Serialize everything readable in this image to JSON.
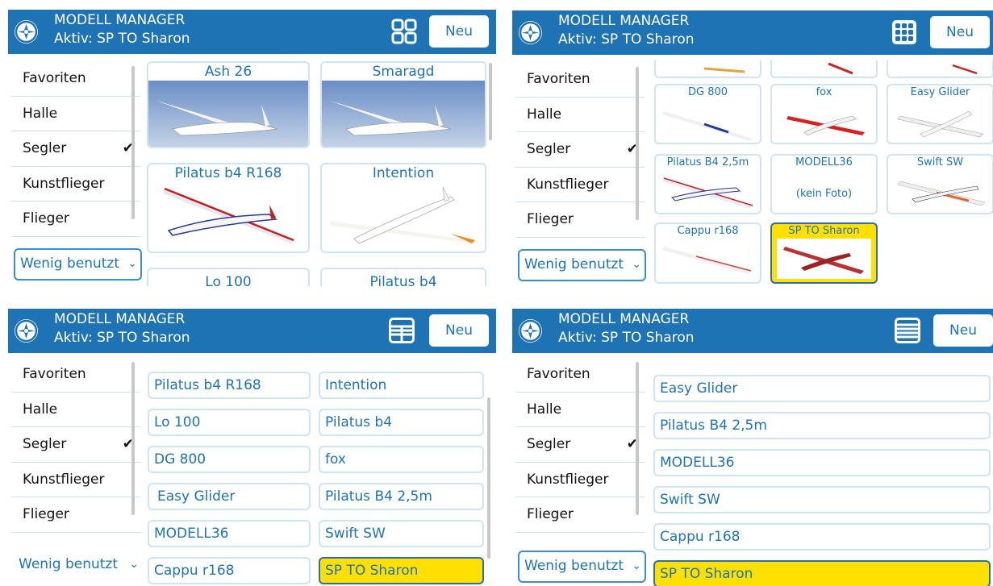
{
  "header": {
    "title": "MODELL MANAGER",
    "active": "Aktiv: SP TO Sharon",
    "new_button": "Neu",
    "logo_icon": "propeller-logo-icon",
    "view_icons": [
      "grid-2x2-icon",
      "grid-3x3-icon",
      "two-column-list-icon",
      "single-column-list-icon"
    ]
  },
  "sidebar": {
    "items": [
      {
        "label": "Favoriten"
      },
      {
        "label": "Halle"
      },
      {
        "label": "Segler",
        "checked": true,
        "check": "✔"
      },
      {
        "label": "Kunstflieger"
      },
      {
        "label": "Flieger"
      }
    ],
    "dropdown": {
      "label": "Wenig benutzt",
      "chevron": "⌄"
    }
  },
  "view1_tiles": [
    {
      "label": "Ash 26"
    },
    {
      "label": "Smaragd"
    },
    {
      "label": "Pilatus b4 R168"
    },
    {
      "label": "Intention"
    },
    {
      "label": "Lo 100"
    },
    {
      "label": "Pilatus b4"
    }
  ],
  "view2_tiles": [
    {
      "label": "DG 800"
    },
    {
      "label": "fox"
    },
    {
      "label": "Easy Glider"
    },
    {
      "label": "Pilatus B4 2,5m"
    },
    {
      "label": "MODELL36",
      "note": "(kein Foto)"
    },
    {
      "label": "Swift SW"
    },
    {
      "label": "Cappu r168"
    },
    {
      "label": "SP TO Sharon",
      "selected": true
    }
  ],
  "view3_rows": [
    {
      "label": "Pilatus b4 R168"
    },
    {
      "label": "Intention"
    },
    {
      "label": "Lo 100"
    },
    {
      "label": "Pilatus b4"
    },
    {
      "label": "DG 800"
    },
    {
      "label": "fox"
    },
    {
      "label": "Easy Glider"
    },
    {
      "label": "Pilatus B4 2,5m"
    },
    {
      "label": "MODELL36"
    },
    {
      "label": "Swift SW"
    },
    {
      "label": "Cappu r168"
    },
    {
      "label": "SP TO Sharon",
      "selected": true
    }
  ],
  "view4_rows": [
    {
      "label": "Easy Glider"
    },
    {
      "label": "Pilatus B4 2,5m"
    },
    {
      "label": "MODELL36"
    },
    {
      "label": "Swift SW"
    },
    {
      "label": "Cappu r168"
    },
    {
      "label": "SP TO Sharon",
      "selected": true
    }
  ],
  "colors": {
    "header": "#1e73b4",
    "accent_text": "#1e73b4",
    "tile_border": "#cfe4f4",
    "selected": "#ffe000"
  }
}
